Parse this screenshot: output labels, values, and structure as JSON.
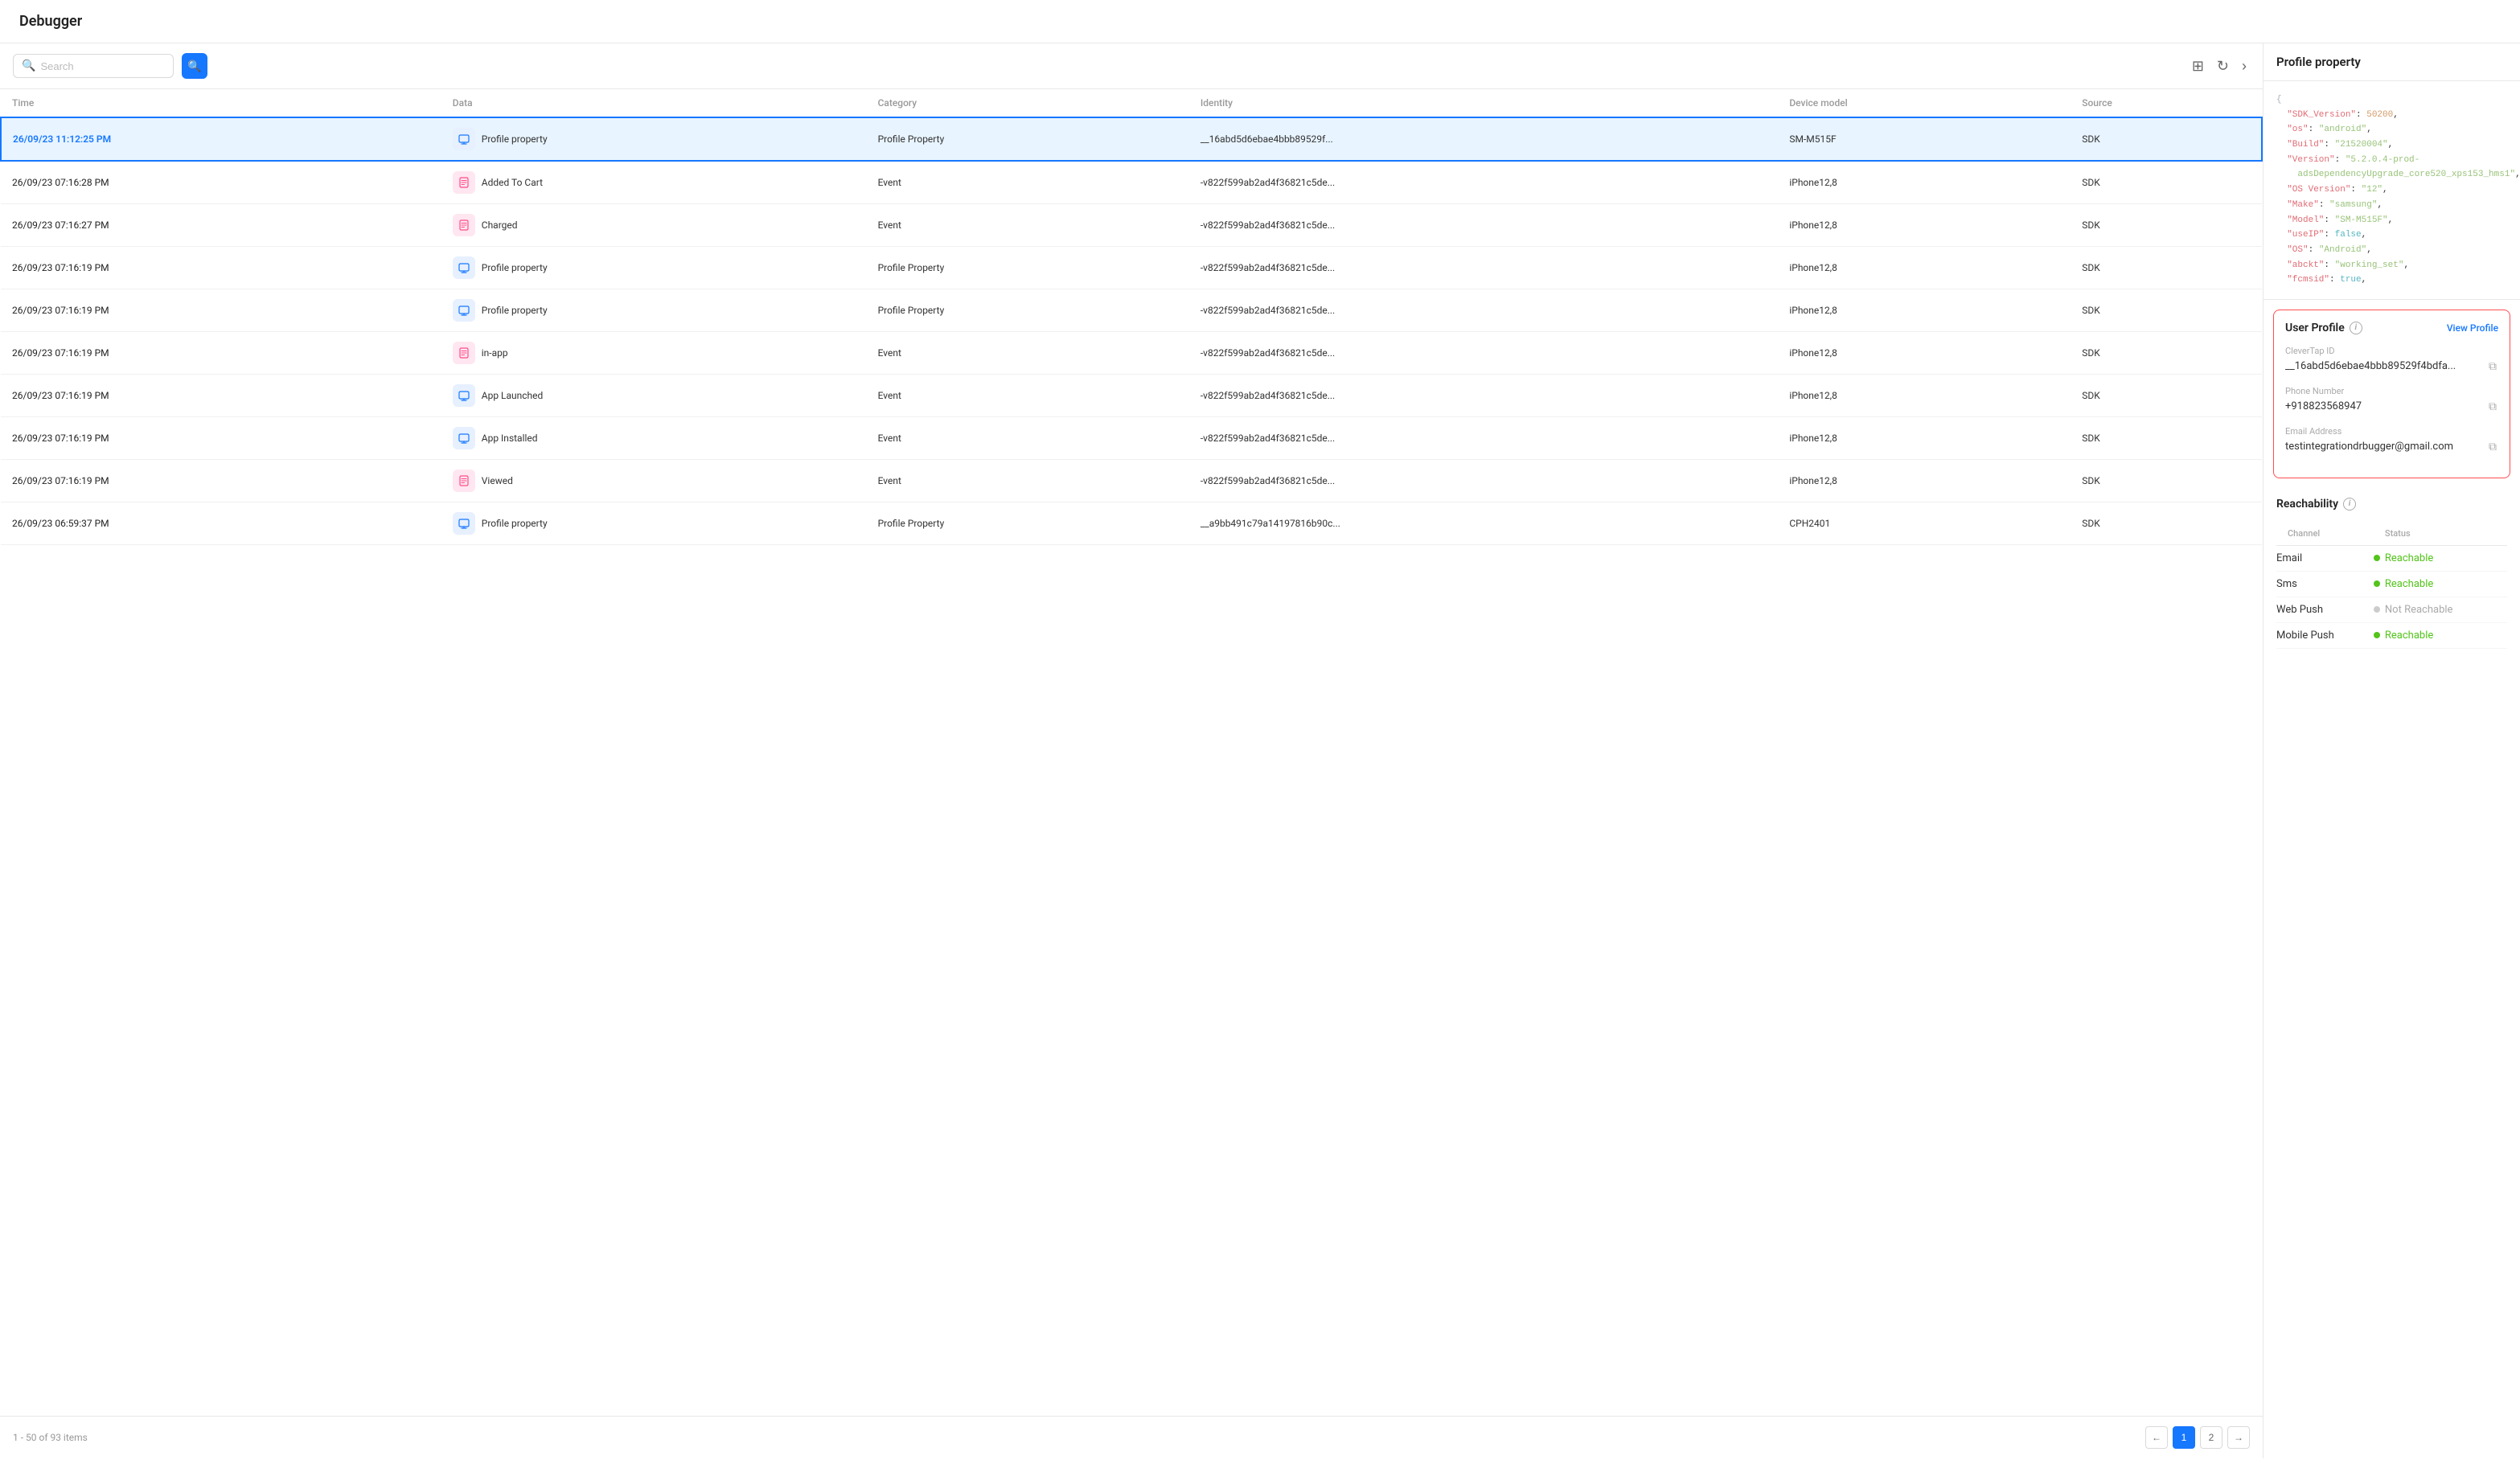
{
  "header": {
    "title": "Debugger"
  },
  "toolbar": {
    "search_placeholder": "Search",
    "search_button_label": "Search"
  },
  "table": {
    "columns": [
      "Time",
      "Data",
      "Category",
      "Identity",
      "Device model",
      "Source"
    ],
    "rows": [
      {
        "id": 1,
        "time": "26/09/23 11:12:25 PM",
        "icon_type": "blue",
        "icon": "🖥",
        "data": "Profile property",
        "category": "Profile Property",
        "identity": "__16abd5d6ebae4bbb89529f...",
        "device_model": "SM-M515F",
        "source": "SDK",
        "selected": true
      },
      {
        "id": 2,
        "time": "26/09/23 07:16:28 PM",
        "icon_type": "pink",
        "icon": "📋",
        "data": "Added To Cart",
        "category": "Event",
        "identity": "-v822f599ab2ad4f36821c5de...",
        "device_model": "iPhone12,8",
        "source": "SDK",
        "selected": false
      },
      {
        "id": 3,
        "time": "26/09/23 07:16:27 PM",
        "icon_type": "pink",
        "icon": "📋",
        "data": "Charged",
        "category": "Event",
        "identity": "-v822f599ab2ad4f36821c5de...",
        "device_model": "iPhone12,8",
        "source": "SDK",
        "selected": false
      },
      {
        "id": 4,
        "time": "26/09/23 07:16:19 PM",
        "icon_type": "blue",
        "icon": "🖥",
        "data": "Profile property",
        "category": "Profile Property",
        "identity": "-v822f599ab2ad4f36821c5de...",
        "device_model": "iPhone12,8",
        "source": "SDK",
        "selected": false
      },
      {
        "id": 5,
        "time": "26/09/23 07:16:19 PM",
        "icon_type": "blue",
        "icon": "🖥",
        "data": "Profile property",
        "category": "Profile Property",
        "identity": "-v822f599ab2ad4f36821c5de...",
        "device_model": "iPhone12,8",
        "source": "SDK",
        "selected": false
      },
      {
        "id": 6,
        "time": "26/09/23 07:16:19 PM",
        "icon_type": "pink",
        "icon": "📋",
        "data": "in-app",
        "category": "Event",
        "identity": "-v822f599ab2ad4f36821c5de...",
        "device_model": "iPhone12,8",
        "source": "SDK",
        "selected": false
      },
      {
        "id": 7,
        "time": "26/09/23 07:16:19 PM",
        "icon_type": "blue",
        "icon": "🖥",
        "data": "App Launched",
        "category": "Event",
        "identity": "-v822f599ab2ad4f36821c5de...",
        "device_model": "iPhone12,8",
        "source": "SDK",
        "selected": false
      },
      {
        "id": 8,
        "time": "26/09/23 07:16:19 PM",
        "icon_type": "blue",
        "icon": "🖥",
        "data": "App Installed",
        "category": "Event",
        "identity": "-v822f599ab2ad4f36821c5de...",
        "device_model": "iPhone12,8",
        "source": "SDK",
        "selected": false
      },
      {
        "id": 9,
        "time": "26/09/23 07:16:19 PM",
        "icon_type": "pink",
        "icon": "📋",
        "data": "Viewed",
        "category": "Event",
        "identity": "-v822f599ab2ad4f36821c5de...",
        "device_model": "iPhone12,8",
        "source": "SDK",
        "selected": false
      },
      {
        "id": 10,
        "time": "26/09/23 06:59:37 PM",
        "icon_type": "blue",
        "icon": "🖥",
        "data": "Profile property",
        "category": "Profile Property",
        "identity": "__a9bb491c79a14197816b90c...",
        "device_model": "CPH2401",
        "source": "SDK",
        "selected": false
      }
    ]
  },
  "pagination": {
    "info": "1 - 50 of 93 items",
    "current_page": 1,
    "pages": [
      1,
      2
    ],
    "prev_label": "←",
    "next_label": "→"
  },
  "right_panel": {
    "title": "Profile property",
    "json_content": [
      {
        "type": "brace",
        "text": "{"
      },
      {
        "type": "key",
        "key": "SDK_Version",
        "value": "50200",
        "value_type": "num"
      },
      {
        "type": "key",
        "key": "os",
        "value": "\"android\"",
        "value_type": "str"
      },
      {
        "type": "key",
        "key": "Build",
        "value": "\"21520004\"",
        "value_type": "str"
      },
      {
        "type": "key",
        "key": "Version",
        "value": "\"5.2.0.4-prod-adsDependencyUpgrade_core520_xps153_hms1\"",
        "value_type": "str"
      },
      {
        "type": "key",
        "key": "OS Version",
        "value": "\"12\"",
        "value_type": "str"
      },
      {
        "type": "key",
        "key": "Make",
        "value": "\"samsung\"",
        "value_type": "str"
      },
      {
        "type": "key",
        "key": "Model",
        "value": "\"SM-M515F\"",
        "value_type": "str"
      },
      {
        "type": "key",
        "key": "useIP",
        "value": "false",
        "value_type": "bool"
      },
      {
        "type": "key",
        "key": "OS",
        "value": "\"Android\"",
        "value_type": "str"
      },
      {
        "type": "key",
        "key": "abckt",
        "value": "\"working_set\"",
        "value_type": "str"
      },
      {
        "type": "key",
        "key": "fcmsid",
        "value": "true",
        "value_type": "bool"
      }
    ],
    "user_profile": {
      "title": "User Profile",
      "view_profile_label": "View Profile",
      "clevertap_id_label": "CleverTap ID",
      "clevertap_id_value": "__16abd5d6ebae4bbb89529f4bdfa...",
      "phone_label": "Phone Number",
      "phone_value": "+918823568947",
      "email_label": "Email Address",
      "email_value": "testintegrationdrbugger@gmail.com"
    },
    "reachability": {
      "title": "Reachability",
      "channel_col": "Channel",
      "status_col": "Status",
      "channels": [
        {
          "name": "Email",
          "status": "Reachable",
          "reachable": true
        },
        {
          "name": "Sms",
          "status": "Reachable",
          "reachable": true
        },
        {
          "name": "Web Push",
          "status": "Not Reachable",
          "reachable": false
        },
        {
          "name": "Mobile Push",
          "status": "Reachable",
          "reachable": true
        }
      ]
    }
  }
}
